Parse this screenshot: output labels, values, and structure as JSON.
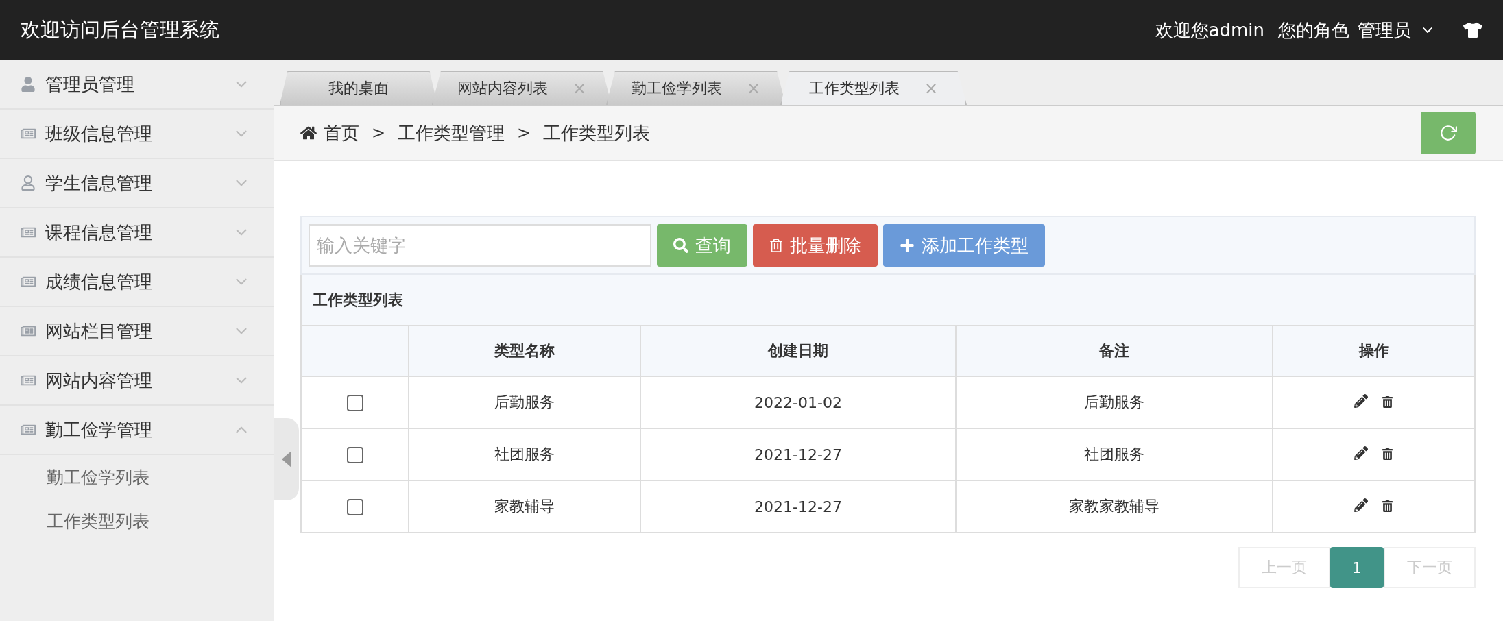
{
  "header": {
    "title": "欢迎访问后台管理系统",
    "welcome": "欢迎您admin",
    "role_label": "您的角色",
    "role": "管理员"
  },
  "sidebar": {
    "items": [
      {
        "label": "管理员管理",
        "kind": "user",
        "expanded": false
      },
      {
        "label": "班级信息管理",
        "kind": "news",
        "expanded": false
      },
      {
        "label": "学生信息管理",
        "kind": "user-outline",
        "expanded": false
      },
      {
        "label": "课程信息管理",
        "kind": "news",
        "expanded": false
      },
      {
        "label": "成绩信息管理",
        "kind": "news",
        "expanded": false
      },
      {
        "label": "网站栏目管理",
        "kind": "news",
        "expanded": false
      },
      {
        "label": "网站内容管理",
        "kind": "news",
        "expanded": false
      },
      {
        "label": "勤工俭学管理",
        "kind": "news",
        "expanded": true,
        "children": [
          {
            "label": "勤工俭学列表"
          },
          {
            "label": "工作类型列表"
          }
        ]
      }
    ]
  },
  "tabs": [
    {
      "label": "我的桌面",
      "selected": false,
      "closable": false
    },
    {
      "label": "网站内容列表",
      "selected": false,
      "closable": true
    },
    {
      "label": "勤工俭学列表",
      "selected": false,
      "closable": true
    },
    {
      "label": "工作类型列表",
      "selected": true,
      "closable": true
    }
  ],
  "close_mark": "×",
  "breadcrumb": {
    "items": [
      "首页",
      "工作类型管理",
      "工作类型列表"
    ],
    "separator": ">"
  },
  "search": {
    "placeholder": "输入关键字"
  },
  "buttons": [
    {
      "label": "查询",
      "kind": "search"
    },
    {
      "label": "批量删除",
      "kind": "delete"
    },
    {
      "label": "添加工作类型",
      "kind": "add"
    }
  ],
  "table": {
    "title": "工作类型列表",
    "columns": [
      "类型名称",
      "创建日期",
      "备注",
      "操作"
    ],
    "rows": [
      {
        "checked": false,
        "cells": [
          "后勤服务",
          "2022-01-02",
          "后勤服务"
        ]
      },
      {
        "checked": false,
        "cells": [
          "社团服务",
          "2021-12-27",
          "社团服务"
        ]
      },
      {
        "checked": false,
        "cells": [
          "家教辅导",
          "2021-12-27",
          "家教家教辅导"
        ]
      }
    ]
  },
  "pagination": {
    "prev": "上一页",
    "pages": [
      {
        "label": "1",
        "selected": true
      }
    ],
    "next": "下一页"
  }
}
